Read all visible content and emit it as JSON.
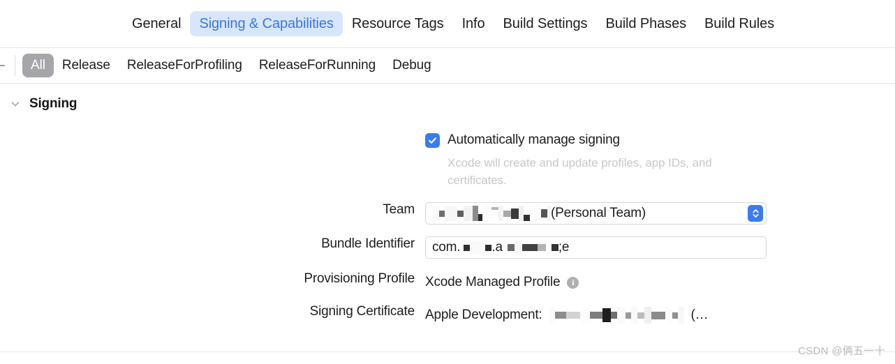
{
  "tabbar": {
    "tabs": [
      {
        "label": "General",
        "selected": false
      },
      {
        "label": "Signing & Capabilities",
        "selected": true
      },
      {
        "label": "Resource Tags",
        "selected": false
      },
      {
        "label": "Info",
        "selected": false
      },
      {
        "label": "Build Settings",
        "selected": false
      },
      {
        "label": "Build Phases",
        "selected": false
      },
      {
        "label": "Build Rules",
        "selected": false
      }
    ]
  },
  "configbar": {
    "collapse_icon": "minus-icon",
    "configs": [
      {
        "label": "All",
        "selected": true
      },
      {
        "label": "Release",
        "selected": false
      },
      {
        "label": "ReleaseForProfiling",
        "selected": false
      },
      {
        "label": "ReleaseForRunning",
        "selected": false
      },
      {
        "label": "Debug",
        "selected": false
      }
    ]
  },
  "signing": {
    "disclosure_icon": "chevron-down-icon",
    "title": "Signing",
    "auto_manage": {
      "checked": true,
      "label": "Automatically manage signing",
      "help": "Xcode will create and update profiles, app IDs, and certificates."
    },
    "team": {
      "label": "Team",
      "value_suffix": "(Personal Team)",
      "redacted": true,
      "stepper_icon": "chevron-up-down-icon"
    },
    "bundle_identifier": {
      "label": "Bundle Identifier",
      "value_prefix": "com.",
      "value_mid": ".a",
      "value_suffix": ";e",
      "redacted": true
    },
    "provisioning_profile": {
      "label": "Provisioning Profile",
      "value": "Xcode Managed Profile",
      "info_icon": "info-circle-icon"
    },
    "signing_certificate": {
      "label": "Signing Certificate",
      "value_prefix": "Apple Development:",
      "value_suffix": "(…",
      "redacted": true
    }
  },
  "watermark": {
    "text": "CSDN @俩五一十"
  },
  "colors": {
    "accent_blue": "#3b7bf0",
    "tab_selected_bg": "#d8e6fd",
    "tab_selected_text": "#3a76e0",
    "segment_selected_bg": "#a6a6aa",
    "help_text": "#c8c8cc"
  }
}
